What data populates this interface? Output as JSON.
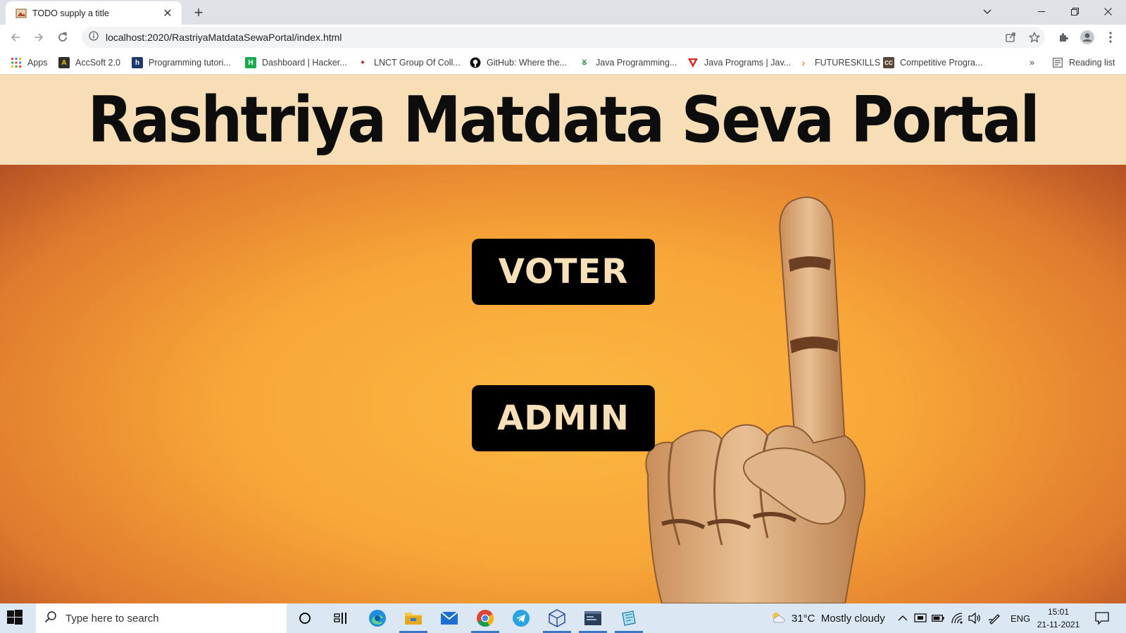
{
  "browser": {
    "tab_title": "TODO supply a title",
    "url": "localhost:2020/RastriyaMatdataSewaPortal/index.html",
    "bookmarks": [
      {
        "label": "Apps",
        "icon": "apps-grid-icon"
      },
      {
        "label": "AccSoft 2.0",
        "icon": "accsoft-icon"
      },
      {
        "label": "Programming tutori...",
        "icon": "h-logo-icon"
      },
      {
        "label": "Dashboard | Hacker...",
        "icon": "hackerrank-icon"
      },
      {
        "label": "LNCT Group Of Coll...",
        "icon": "lnct-icon"
      },
      {
        "label": "GitHub: Where the...",
        "icon": "github-icon"
      },
      {
        "label": "Java Programming...",
        "icon": "gfg-icon"
      },
      {
        "label": "Java Programs | Jav...",
        "icon": "javatpoint-icon"
      },
      {
        "label": "FUTURESKILLS",
        "icon": "futureskills-icon"
      },
      {
        "label": "Competitive Progra...",
        "icon": "codechef-icon"
      }
    ],
    "overflow_label": "»",
    "reading_list": "Reading list"
  },
  "page": {
    "title": "Rashtriya Matdata Seva Portal",
    "buttons": {
      "voter": "VOTER",
      "admin": "ADMIN"
    }
  },
  "taskbar": {
    "search_placeholder": "Type here to search",
    "weather": "31°C  Mostly cloudy",
    "language": "ENG",
    "time": "15:01",
    "date": "21-11-2021"
  },
  "colors": {
    "header_bg": "#f7deb6",
    "hero_center": "#fdb642",
    "hero_edge": "#9e3a1f",
    "button_bg": "#000000",
    "button_text": "#f7e0b8"
  }
}
